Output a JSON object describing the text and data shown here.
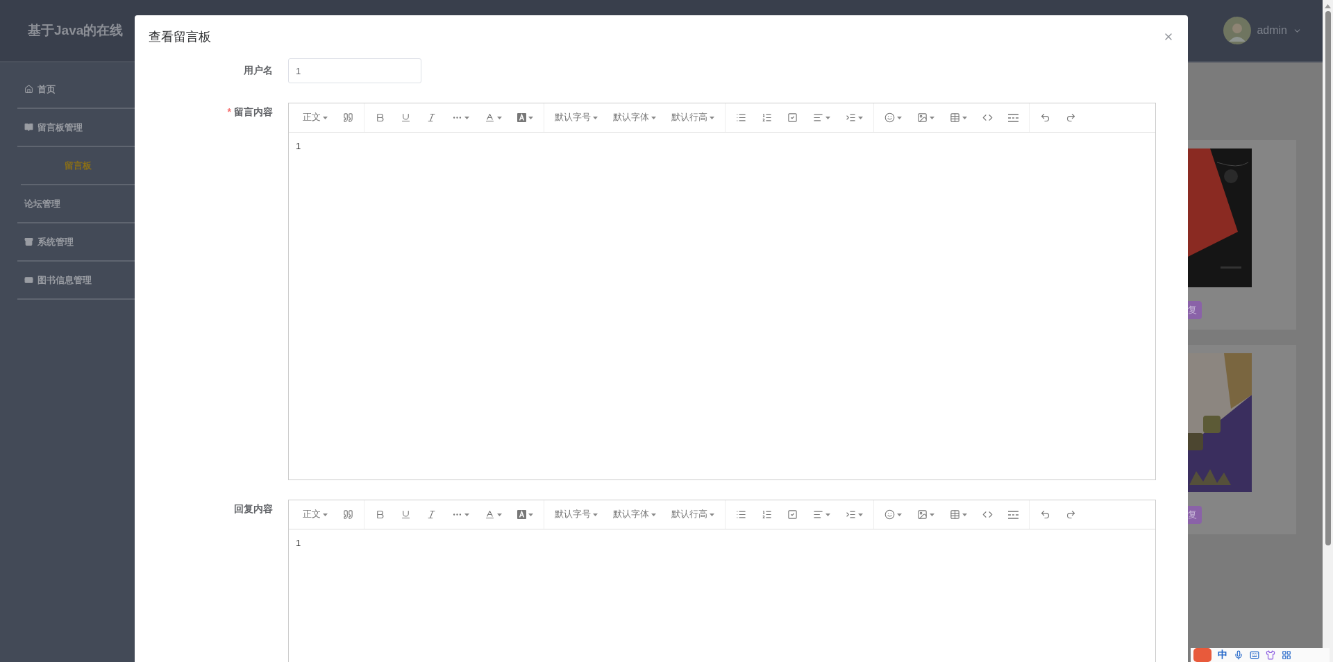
{
  "header": {
    "title": "基于Java的在线",
    "user": "admin"
  },
  "sidebar": {
    "items": [
      {
        "label": "首页",
        "selected": false
      },
      {
        "label": "留言板管理",
        "selected": false,
        "children": [
          {
            "label": "留言板",
            "selected": true
          }
        ]
      },
      {
        "label": "论坛管理",
        "selected": false
      },
      {
        "label": "系统管理",
        "selected": false
      },
      {
        "label": "图书信息管理",
        "selected": false
      }
    ]
  },
  "background_cards": [
    {
      "kind": "picture",
      "button": "复"
    },
    {
      "kind": "picture",
      "button": "复"
    }
  ],
  "dialog": {
    "title": "查看留言板",
    "username": {
      "label": "用户名",
      "value": "1"
    },
    "editors": [
      {
        "label": "留言内容",
        "required_mark": "*",
        "toolbar": {
          "paragraph": "正文",
          "font_size": "默认字号",
          "font_family": "默认字体",
          "line_height": "默认行高"
        },
        "content": "1"
      },
      {
        "label": "回复内容",
        "toolbar": {
          "paragraph": "正文",
          "font_size": "默认字号",
          "font_family": "默认字体",
          "line_height": "默认行高"
        },
        "content": "1"
      }
    ]
  },
  "ime_bar": {
    "mode": "中"
  }
}
